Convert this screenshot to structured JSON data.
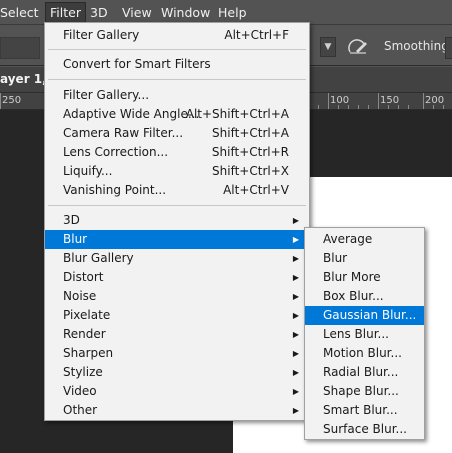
{
  "menubar": {
    "items": [
      "Select",
      "Filter",
      "3D",
      "View",
      "Window",
      "Help"
    ],
    "open_item": "Filter"
  },
  "options_bar": {
    "smoothing_label": "Smoothing:",
    "dropdown_icon": "chevron-down-icon",
    "brush_icon": "brush-angle-icon"
  },
  "document": {
    "tab_label": "ayer 1,",
    "ruler_ticks": [
      "250",
      "100",
      "150",
      "200"
    ]
  },
  "filter_menu": {
    "items": [
      {
        "label": "Filter Gallery",
        "shortcut": "Alt+Ctrl+F"
      },
      {
        "label": "Convert for Smart Filters",
        "shortcut": ""
      },
      {
        "label": "Filter Gallery...",
        "shortcut": ""
      },
      {
        "label": "Adaptive Wide Angle...",
        "shortcut": "Alt+Shift+Ctrl+A"
      },
      {
        "label": "Camera Raw Filter...",
        "shortcut": "Shift+Ctrl+A"
      },
      {
        "label": "Lens Correction...",
        "shortcut": "Shift+Ctrl+R"
      },
      {
        "label": "Liquify...",
        "shortcut": "Shift+Ctrl+X"
      },
      {
        "label": "Vanishing Point...",
        "shortcut": "Alt+Ctrl+V"
      },
      {
        "label": "3D",
        "submenu": true
      },
      {
        "label": "Blur",
        "submenu": true,
        "highlighted": true
      },
      {
        "label": "Blur Gallery",
        "submenu": true
      },
      {
        "label": "Distort",
        "submenu": true
      },
      {
        "label": "Noise",
        "submenu": true
      },
      {
        "label": "Pixelate",
        "submenu": true
      },
      {
        "label": "Render",
        "submenu": true
      },
      {
        "label": "Sharpen",
        "submenu": true
      },
      {
        "label": "Stylize",
        "submenu": true
      },
      {
        "label": "Video",
        "submenu": true
      },
      {
        "label": "Other",
        "submenu": true
      }
    ]
  },
  "blur_submenu": {
    "items": [
      {
        "label": "Average"
      },
      {
        "label": "Blur"
      },
      {
        "label": "Blur More"
      },
      {
        "label": "Box Blur..."
      },
      {
        "label": "Gaussian Blur...",
        "highlighted": true
      },
      {
        "label": "Lens Blur..."
      },
      {
        "label": "Motion Blur..."
      },
      {
        "label": "Radial Blur..."
      },
      {
        "label": "Shape Blur..."
      },
      {
        "label": "Smart Blur..."
      },
      {
        "label": "Surface Blur..."
      }
    ]
  },
  "colors": {
    "highlight": "#0078d7",
    "menu_bg": "#f2f2f2",
    "app_bg": "#535353",
    "canvas_bg": "#262626"
  }
}
